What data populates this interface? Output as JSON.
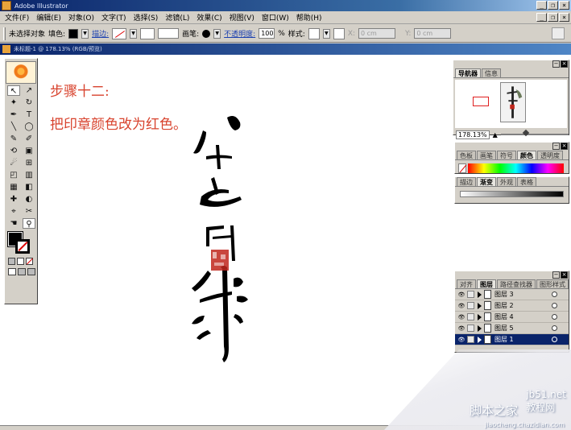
{
  "window": {
    "title": "Adobe Illustrator"
  },
  "menubar": {
    "items": [
      "文件(F)",
      "编辑(E)",
      "对象(O)",
      "文字(T)",
      "选择(S)",
      "滤镜(L)",
      "效果(C)",
      "视图(V)",
      "窗口(W)",
      "帮助(H)"
    ]
  },
  "controlbar": {
    "selection_status": "未选择对象",
    "fill_label": "填色:",
    "stroke_label": "描边:",
    "brush_label": "画笔:",
    "opacity_label": "不透明度:",
    "opacity_value": "100",
    "percent": "%",
    "style_label": "样式:",
    "x_label": "X:",
    "x_value": "0 cm",
    "y_label": "Y:",
    "y_value": "0 cm"
  },
  "document": {
    "title": "未标题-1 @ 178.13% (RGB/预览)"
  },
  "canvas": {
    "step_title": "步骤十二:",
    "step_desc": "把印章颜色改为红色。"
  },
  "toolbox": {
    "tools": [
      "↖",
      "↗",
      "✦",
      "↻",
      "✒",
      "T",
      "╲",
      "◯",
      "✎",
      "✐",
      "⟲",
      "▣",
      "☄",
      "⊞",
      "◰",
      "▥",
      "▦",
      "◧",
      "✚",
      "◐",
      "⌖",
      "✂",
      "☚",
      "⚲"
    ]
  },
  "navigator": {
    "tabs": [
      "导航器",
      "信息"
    ],
    "zoom": "178.13%"
  },
  "color_panel": {
    "tabs": [
      "色板",
      "画笔",
      "符号",
      "颜色",
      "透明度"
    ]
  },
  "gradient_panel": {
    "tabs": [
      "描边",
      "渐变",
      "外观",
      "表格"
    ]
  },
  "layers_panel": {
    "tabs": [
      "对齐",
      "图层",
      "路径查找器",
      "图形样式"
    ],
    "layers": [
      {
        "name": "图层 3",
        "selected": false
      },
      {
        "name": "图层 2",
        "selected": false
      },
      {
        "name": "图层 4",
        "selected": false
      },
      {
        "name": "图层 5",
        "selected": false
      },
      {
        "name": "图层 1",
        "selected": true
      }
    ]
  },
  "watermark": {
    "site_text": "脚本之家",
    "label": "教程网",
    "domain": "jb51.net",
    "url": "jiaocheng.chazidian.com"
  },
  "colors": {
    "step_text": "#d8432e",
    "seal_red": "#c0261c",
    "title_blue": "#0a246a"
  }
}
